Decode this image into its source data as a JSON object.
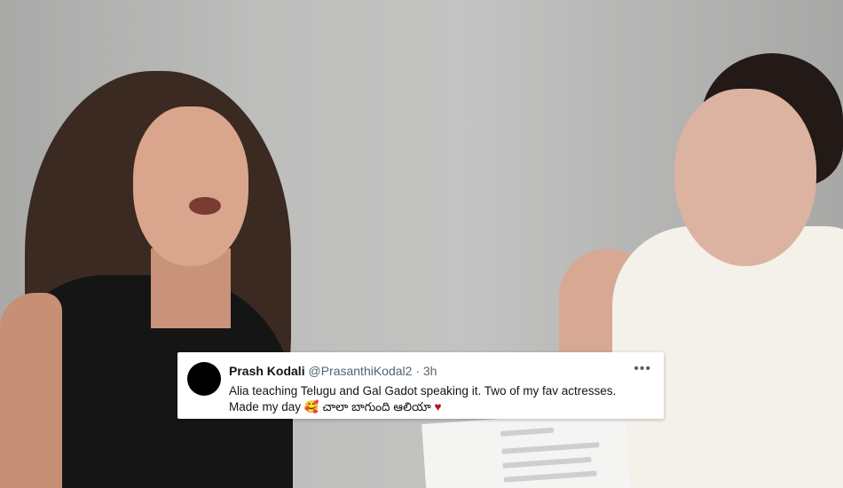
{
  "tweet": {
    "name": "Prash Kodali",
    "handle": "@PrasanthiKodal2",
    "separator": "·",
    "time": "3h",
    "text_line1": "Alia teaching Telugu and Gal Gadot speaking it. Two of my fav actresses.",
    "text_line2": "Made my day",
    "emoji": "🥰",
    "telugu": "చాలా బాగుంది ఆలియా",
    "heart": "♥",
    "more": "•••"
  },
  "icons": {
    "avatar": "avatar",
    "more": "more-options-icon"
  },
  "colors": {
    "name": "#0f1419",
    "secondary": "#536471",
    "heart": "#b3121f",
    "card": "#ffffff"
  }
}
